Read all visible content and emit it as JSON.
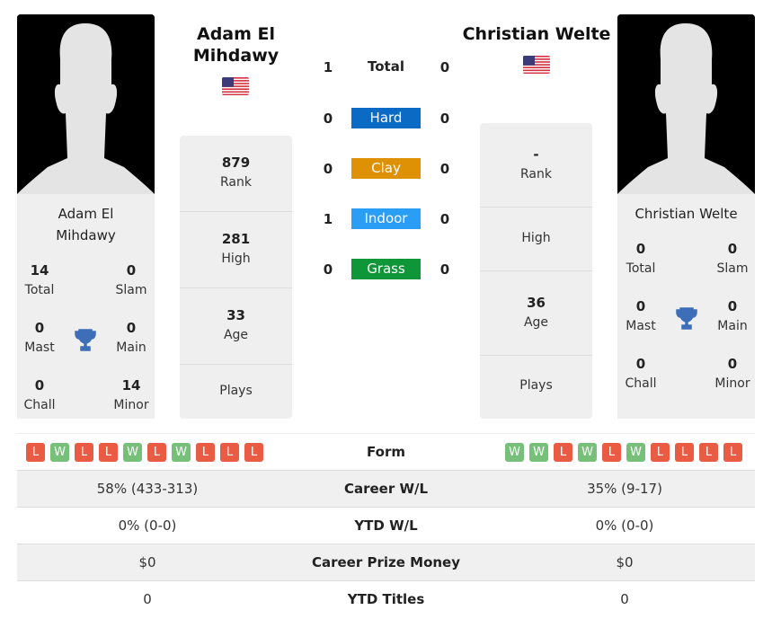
{
  "colors": {
    "hard": "#0b6bc4",
    "clay": "#de9105",
    "indoor": "#2a9df4",
    "grass": "#0f9638",
    "win": "#76c07a",
    "loss": "#ea5b44",
    "trophy": "#3d6eb7"
  },
  "player1": {
    "name": "Adam El Mihdawy",
    "name_line1": "Adam El",
    "name_line2": "Mihdawy",
    "title_line1": "Adam El",
    "title_line2": "Mihdawy",
    "flag": "us-flag",
    "titles": {
      "total": {
        "value": "14",
        "label": "Total"
      },
      "slam": {
        "value": "0",
        "label": "Slam"
      },
      "mast": {
        "value": "0",
        "label": "Mast"
      },
      "main": {
        "value": "0",
        "label": "Main"
      },
      "chall": {
        "value": "0",
        "label": "Chall"
      },
      "minor": {
        "value": "14",
        "label": "Minor"
      }
    },
    "info": [
      {
        "value": "879",
        "label": "Rank"
      },
      {
        "value": "281",
        "label": "High"
      },
      {
        "value": "33",
        "label": "Age"
      },
      {
        "value": "",
        "label": "Plays"
      }
    ],
    "form": [
      "L",
      "W",
      "L",
      "L",
      "W",
      "L",
      "W",
      "L",
      "L",
      "L"
    ]
  },
  "player2": {
    "name": "Christian Welte",
    "title": "Christian Welte",
    "flag": "us-flag",
    "titles": {
      "total": {
        "value": "0",
        "label": "Total"
      },
      "slam": {
        "value": "0",
        "label": "Slam"
      },
      "mast": {
        "value": "0",
        "label": "Mast"
      },
      "main": {
        "value": "0",
        "label": "Main"
      },
      "chall": {
        "value": "0",
        "label": "Chall"
      },
      "minor": {
        "value": "0",
        "label": "Minor"
      }
    },
    "info": [
      {
        "value": "-",
        "label": "Rank"
      },
      {
        "value": "",
        "label": "High"
      },
      {
        "value": "36",
        "label": "Age"
      },
      {
        "value": "",
        "label": "Plays"
      }
    ],
    "form": [
      "W",
      "W",
      "L",
      "W",
      "L",
      "W",
      "L",
      "L",
      "L",
      "L"
    ]
  },
  "h2h": [
    {
      "label": "Total",
      "p1": "1",
      "p2": "0",
      "surface": "total"
    },
    {
      "label": "Hard",
      "p1": "0",
      "p2": "0",
      "surface": "hard"
    },
    {
      "label": "Clay",
      "p1": "0",
      "p2": "0",
      "surface": "clay"
    },
    {
      "label": "Indoor",
      "p1": "1",
      "p2": "0",
      "surface": "indoor"
    },
    {
      "label": "Grass",
      "p1": "0",
      "p2": "0",
      "surface": "grass"
    }
  ],
  "comparison": [
    {
      "label": "Form",
      "p1": "",
      "p2": ""
    },
    {
      "label": "Career W/L",
      "p1": "58% (433-313)",
      "p2": "35% (9-17)"
    },
    {
      "label": "YTD W/L",
      "p1": "0% (0-0)",
      "p2": "0% (0-0)"
    },
    {
      "label": "Career Prize Money",
      "p1": "$0",
      "p2": "$0"
    },
    {
      "label": "YTD Titles",
      "p1": "0",
      "p2": "0"
    }
  ]
}
